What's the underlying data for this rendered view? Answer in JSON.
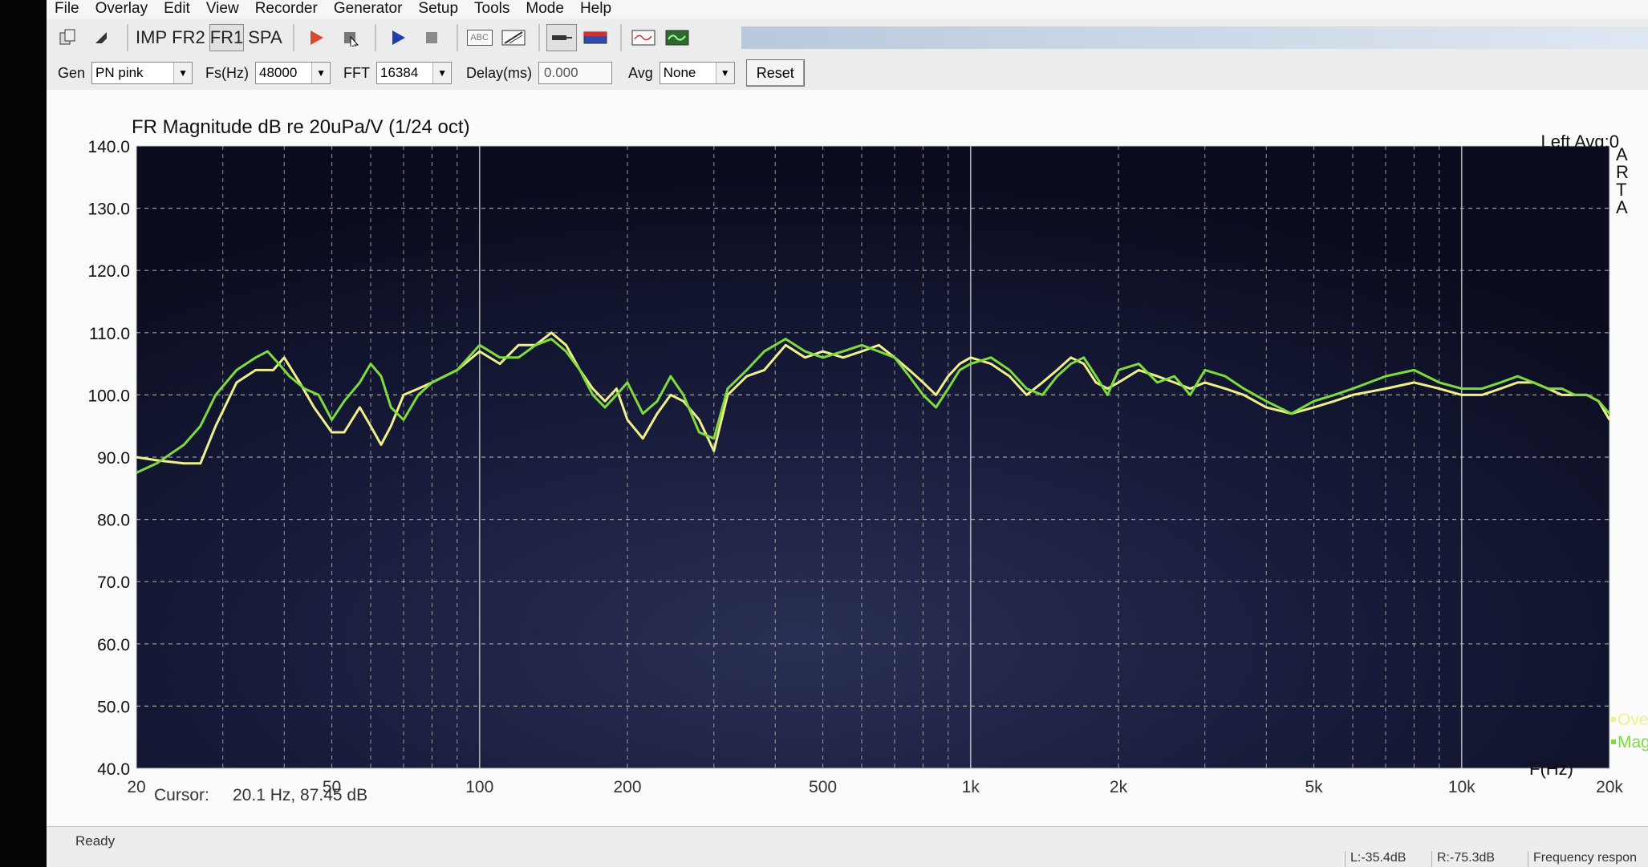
{
  "menu": [
    "File",
    "Overlay",
    "Edit",
    "View",
    "Recorder",
    "Generator",
    "Setup",
    "Tools",
    "Mode",
    "Help"
  ],
  "toolbar": {
    "mode_buttons": [
      "IMP",
      "FR2",
      "FR1",
      "SPA"
    ],
    "abc_label": "ABC"
  },
  "controls": {
    "gen_label": "Gen",
    "gen_value": "PN pink",
    "fs_label": "Fs(Hz)",
    "fs_value": "48000",
    "fft_label": "FFT",
    "fft_value": "16384",
    "delay_label": "Delay(ms)",
    "delay_value": "0.000",
    "avg_label": "Avg",
    "avg_value": "None",
    "reset_label": "Reset"
  },
  "graph": {
    "title": "FR Magnitude dB re 20uPa/V (1/24 oct)",
    "channel_info": "Left  Avg:0",
    "side_label": "ARTA",
    "freq_axis_label": "F(Hz)",
    "cursor_label": "Cursor:",
    "cursor_value": "20.1 Hz, 87.45 dB"
  },
  "chart_data": {
    "type": "line",
    "xscale": "log",
    "xlim": [
      20,
      20000
    ],
    "ylim": [
      40,
      140
    ],
    "grid": true,
    "y_ticks": [
      "140.0",
      "130.0",
      "120.0",
      "110.0",
      "100.0",
      "90.0",
      "80.0",
      "70.0",
      "60.0",
      "50.0",
      "40.0"
    ],
    "x_tick_labels": [
      {
        "value": 20,
        "label": "20"
      },
      {
        "value": 50,
        "label": "50"
      },
      {
        "value": 100,
        "label": "100"
      },
      {
        "value": 200,
        "label": "200"
      },
      {
        "value": 500,
        "label": "500"
      },
      {
        "value": 1000,
        "label": "1k"
      },
      {
        "value": 2000,
        "label": "2k"
      },
      {
        "value": 5000,
        "label": "5k"
      },
      {
        "value": 10000,
        "label": "10k"
      },
      {
        "value": 20000,
        "label": "20k"
      }
    ],
    "legend": {
      "placement": "bottom-right",
      "entries": [
        "Over",
        "Magn"
      ]
    },
    "series": [
      {
        "name": "Over",
        "color": "#f0f08a",
        "points": [
          [
            20,
            90
          ],
          [
            22,
            89.5
          ],
          [
            25,
            89
          ],
          [
            27,
            89
          ],
          [
            29,
            95
          ],
          [
            32,
            102
          ],
          [
            35,
            104
          ],
          [
            38,
            104
          ],
          [
            40,
            106
          ],
          [
            43,
            102
          ],
          [
            46,
            98
          ],
          [
            50,
            94
          ],
          [
            53,
            94
          ],
          [
            57,
            98
          ],
          [
            60,
            95
          ],
          [
            63,
            92
          ],
          [
            66,
            95
          ],
          [
            70,
            100
          ],
          [
            75,
            101
          ],
          [
            80,
            102
          ],
          [
            90,
            104
          ],
          [
            100,
            107
          ],
          [
            110,
            105
          ],
          [
            120,
            108
          ],
          [
            130,
            108
          ],
          [
            140,
            110
          ],
          [
            150,
            108
          ],
          [
            160,
            104
          ],
          [
            170,
            101
          ],
          [
            180,
            99
          ],
          [
            190,
            101
          ],
          [
            200,
            96
          ],
          [
            215,
            93
          ],
          [
            230,
            97
          ],
          [
            245,
            100
          ],
          [
            260,
            99
          ],
          [
            280,
            96
          ],
          [
            300,
            91
          ],
          [
            320,
            100
          ],
          [
            350,
            103
          ],
          [
            380,
            104
          ],
          [
            420,
            108
          ],
          [
            460,
            106
          ],
          [
            500,
            107
          ],
          [
            550,
            106
          ],
          [
            600,
            107
          ],
          [
            650,
            108
          ],
          [
            700,
            106
          ],
          [
            750,
            104
          ],
          [
            800,
            102
          ],
          [
            850,
            100
          ],
          [
            900,
            103
          ],
          [
            950,
            105
          ],
          [
            1000,
            106
          ],
          [
            1100,
            105
          ],
          [
            1200,
            103
          ],
          [
            1300,
            100
          ],
          [
            1400,
            102
          ],
          [
            1500,
            104
          ],
          [
            1600,
            106
          ],
          [
            1700,
            105
          ],
          [
            1800,
            102
          ],
          [
            1900,
            101
          ],
          [
            2000,
            102
          ],
          [
            2200,
            104
          ],
          [
            2400,
            103
          ],
          [
            2600,
            102
          ],
          [
            2800,
            101
          ],
          [
            3000,
            102
          ],
          [
            3300,
            101
          ],
          [
            3600,
            100
          ],
          [
            4000,
            98
          ],
          [
            4500,
            97
          ],
          [
            5000,
            98
          ],
          [
            5500,
            99
          ],
          [
            6000,
            100
          ],
          [
            7000,
            101
          ],
          [
            8000,
            102
          ],
          [
            9000,
            101
          ],
          [
            10000,
            100
          ],
          [
            11000,
            100
          ],
          [
            12000,
            101
          ],
          [
            13000,
            102
          ],
          [
            14000,
            102
          ],
          [
            15000,
            101
          ],
          [
            16000,
            100
          ],
          [
            17000,
            100
          ],
          [
            18000,
            100
          ],
          [
            19000,
            99
          ],
          [
            20000,
            96
          ]
        ]
      },
      {
        "name": "Magn",
        "color": "#7ddc3c",
        "points": [
          [
            20,
            87.5
          ],
          [
            22,
            89
          ],
          [
            25,
            92
          ],
          [
            27,
            95
          ],
          [
            29,
            100
          ],
          [
            32,
            104
          ],
          [
            35,
            106
          ],
          [
            37,
            107
          ],
          [
            39,
            105
          ],
          [
            41,
            103
          ],
          [
            44,
            101
          ],
          [
            47,
            100
          ],
          [
            50,
            96
          ],
          [
            53,
            99
          ],
          [
            57,
            102
          ],
          [
            60,
            105
          ],
          [
            63,
            103
          ],
          [
            66,
            98
          ],
          [
            70,
            96
          ],
          [
            75,
            100
          ],
          [
            80,
            102
          ],
          [
            90,
            104
          ],
          [
            100,
            108
          ],
          [
            110,
            106
          ],
          [
            120,
            106
          ],
          [
            130,
            108
          ],
          [
            140,
            109
          ],
          [
            150,
            107
          ],
          [
            160,
            104
          ],
          [
            170,
            100
          ],
          [
            180,
            98
          ],
          [
            190,
            100
          ],
          [
            200,
            102
          ],
          [
            215,
            97
          ],
          [
            230,
            99
          ],
          [
            245,
            103
          ],
          [
            260,
            100
          ],
          [
            280,
            94
          ],
          [
            300,
            93
          ],
          [
            320,
            101
          ],
          [
            350,
            104
          ],
          [
            380,
            107
          ],
          [
            420,
            109
          ],
          [
            460,
            107
          ],
          [
            500,
            106
          ],
          [
            550,
            107
          ],
          [
            600,
            108
          ],
          [
            650,
            107
          ],
          [
            700,
            106
          ],
          [
            750,
            103
          ],
          [
            800,
            100
          ],
          [
            850,
            98
          ],
          [
            900,
            101
          ],
          [
            950,
            104
          ],
          [
            1000,
            105
          ],
          [
            1100,
            106
          ],
          [
            1200,
            104
          ],
          [
            1300,
            101
          ],
          [
            1400,
            100
          ],
          [
            1500,
            103
          ],
          [
            1600,
            105
          ],
          [
            1700,
            106
          ],
          [
            1800,
            103
          ],
          [
            1900,
            100
          ],
          [
            2000,
            104
          ],
          [
            2200,
            105
          ],
          [
            2400,
            102
          ],
          [
            2600,
            103
          ],
          [
            2800,
            100
          ],
          [
            3000,
            104
          ],
          [
            3300,
            103
          ],
          [
            3600,
            101
          ],
          [
            4000,
            99
          ],
          [
            4500,
            97
          ],
          [
            5000,
            99
          ],
          [
            5500,
            100
          ],
          [
            6000,
            101
          ],
          [
            7000,
            103
          ],
          [
            8000,
            104
          ],
          [
            9000,
            102
          ],
          [
            10000,
            101
          ],
          [
            11000,
            101
          ],
          [
            12000,
            102
          ],
          [
            13000,
            103
          ],
          [
            14000,
            102
          ],
          [
            15000,
            101
          ],
          [
            16000,
            101
          ],
          [
            17000,
            100
          ],
          [
            18000,
            100
          ],
          [
            19000,
            99
          ],
          [
            20000,
            97
          ]
        ]
      }
    ]
  },
  "status": {
    "ready": "Ready",
    "left_level": "L:-35.4dB",
    "right_level": "R:-75.3dB",
    "mode_text": "Frequency respon"
  }
}
